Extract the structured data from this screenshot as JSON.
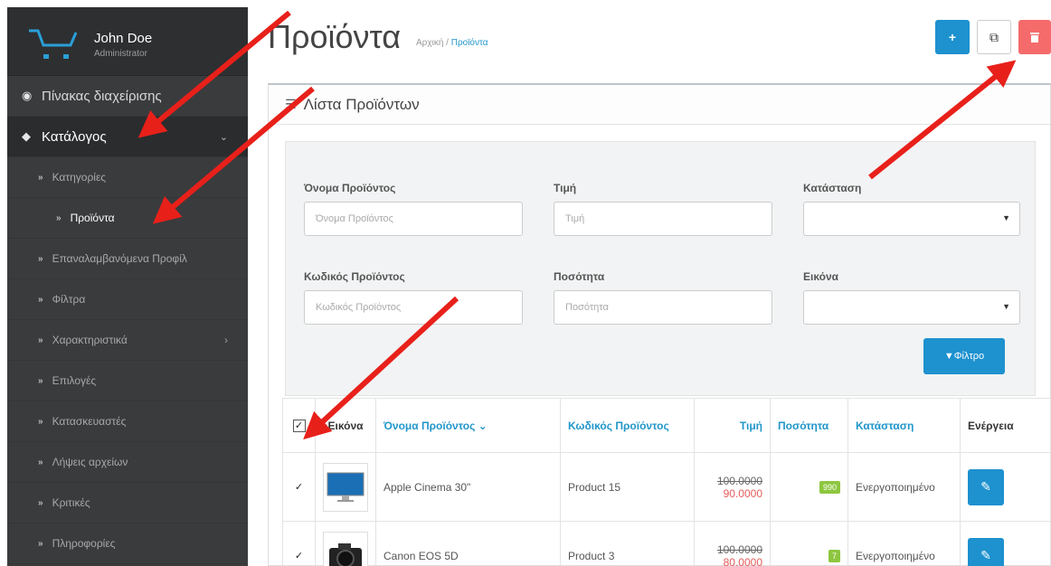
{
  "sidebar": {
    "user_name": "John Doe",
    "user_role": "Administrator",
    "dashboard": "Πίνακας διαχείρισης",
    "catalog": "Κατάλογος",
    "catalog_items": [
      "Κατηγορίες",
      "Προϊόντα",
      "Επαναλαμβανόμενα Προφίλ",
      "Φίλτρα",
      "Χαρακτηριστικά",
      "Επιλογές",
      "Κατασκευαστές",
      "Λήψεις αρχείων",
      "Κριτικές",
      "Πληροφορίες"
    ]
  },
  "header": {
    "title": "Προϊόντα",
    "breadcrumb_home": "Αρχική",
    "breadcrumb_sep": "/",
    "breadcrumb_current": "Προϊόντα"
  },
  "panel": {
    "title": "Λίστα Προϊόντων"
  },
  "filter": {
    "name_label": "Όνομα Προϊόντος",
    "name_placeholder": "Όνομα Προϊόντος",
    "price_label": "Τιμή",
    "price_placeholder": "Τιμή",
    "status_label": "Κατάσταση",
    "model_label": "Κωδικός Προϊόντος",
    "model_placeholder": "Κωδικός Προϊόντος",
    "quantity_label": "Ποσότητα",
    "quantity_placeholder": "Ποσότητα",
    "image_label": "Εικόνα",
    "button_label": "Φίλτρο"
  },
  "table": {
    "headers": {
      "image": "Εικόνα",
      "name": "Όνομα Προϊόντος",
      "model": "Κωδικός Προϊόντος",
      "price": "Τιμή",
      "quantity": "Ποσότητα",
      "status": "Κατάσταση",
      "action": "Ενέργεια"
    },
    "rows": [
      {
        "name": "Apple Cinema 30\"",
        "model": "Product 15",
        "old_price": "100.0000",
        "new_price": "90.0000",
        "quantity": "990",
        "status": "Ενεργοποιημένο"
      },
      {
        "name": "Canon EOS 5D",
        "model": "Product 3",
        "old_price": "100.0000",
        "new_price": "80.0000",
        "quantity": "7",
        "status": "Ενεργοποιημένο"
      }
    ]
  },
  "colors": {
    "accent": "#1e91cf",
    "danger": "#f56b6b",
    "sidebar": "#3a3b3d",
    "arrow": "#e8201a"
  }
}
